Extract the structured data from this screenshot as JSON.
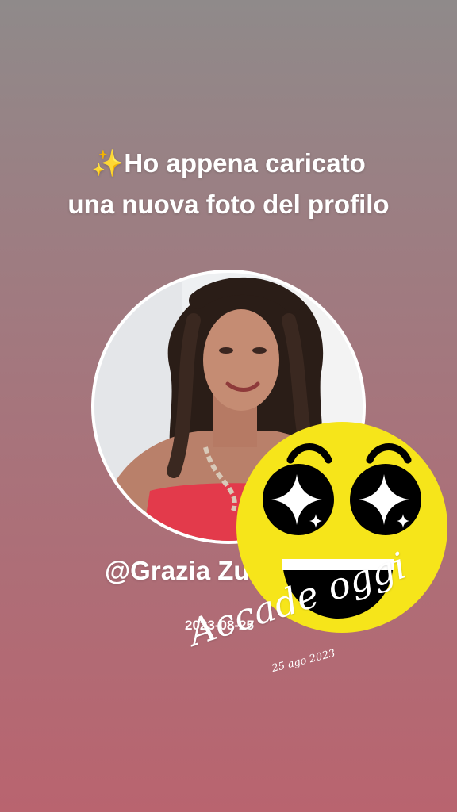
{
  "post": {
    "headline_line1": "✨Ho appena caricato",
    "headline_line2": "una nuova foto del profilo",
    "username": "@Grazia Zuccaro",
    "date": "2023-08-25"
  },
  "profile_photo": {
    "icon": "profile-photo"
  },
  "sticker": {
    "icon": "star-eyes-laughing-emoji",
    "title": "Accade oggi",
    "date": "25 ago 2023"
  },
  "colors": {
    "background_top": "#8f8a8a",
    "background_bottom": "#b9646f",
    "emoji_yellow": "#f6e51a",
    "text": "#ffffff"
  }
}
